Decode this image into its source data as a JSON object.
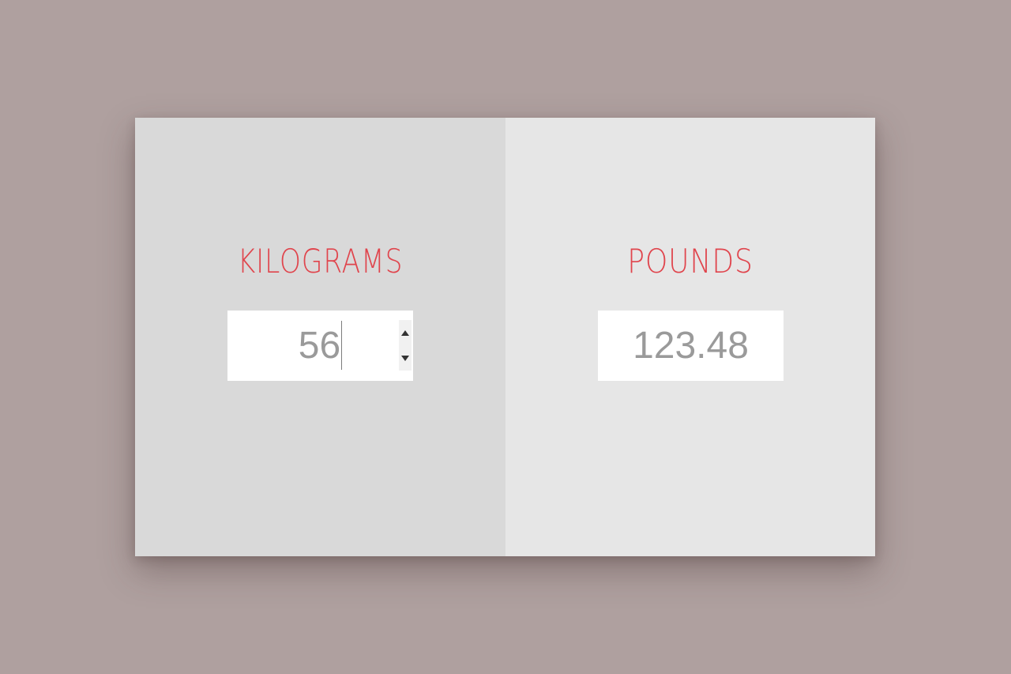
{
  "colors": {
    "background": "#afa09f",
    "left_panel": "#d9d9d9",
    "right_panel": "#e6e6e6",
    "title_accent": "#e0454d",
    "value_text": "#9a9a9a"
  },
  "kilograms": {
    "title": "KILOGRAMS",
    "value": "56",
    "spinner_up_icon": "triangle-up-icon",
    "spinner_down_icon": "triangle-down-icon"
  },
  "pounds": {
    "title": "POUNDS",
    "value": "123.48"
  }
}
